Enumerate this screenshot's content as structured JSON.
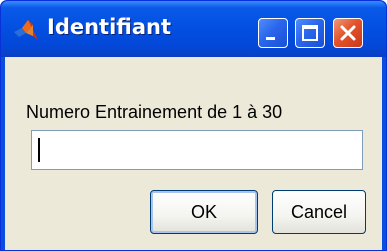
{
  "window": {
    "title": "Identifiant",
    "icons": {
      "app": "matlab-logo-icon",
      "minimize": "minimize-icon",
      "maximize": "maximize-icon",
      "close": "close-icon"
    }
  },
  "dialog": {
    "prompt": "Numero Entrainement de 1 à 30",
    "input_value": "",
    "ok_label": "OK",
    "cancel_label": "Cancel"
  },
  "colors": {
    "titlebar": "#0350e2",
    "client_background": "#ece9d8",
    "close_button": "#e2542b",
    "input_border": "#7f9db9"
  }
}
